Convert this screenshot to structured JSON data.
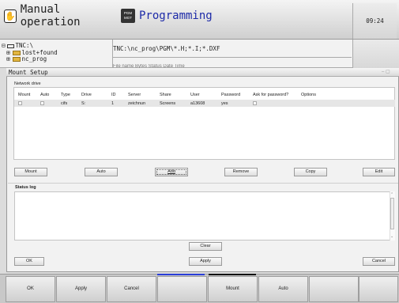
{
  "header": {
    "mode_manual": "Manual operation",
    "mode_programming": "Programming",
    "pgm_badge": "PGM MGT",
    "clock": "09:24"
  },
  "file_manager": {
    "tree": [
      "TNC:\\",
      "lost+found",
      "nc_prog"
    ],
    "path": "TNC:\\nc_prog\\PGM\\*.H;*.I;*.DXF",
    "columns": "File name            Bytes Status   Date      Time"
  },
  "dialog": {
    "title": "Mount Setup",
    "window_controls": "– ▢",
    "network_drive_label": "Network drive",
    "table": {
      "headers": [
        "Mount",
        "Auto",
        "Type",
        "Drive",
        "ID",
        "Server",
        "Share",
        "User",
        "Password",
        "Ask for password?",
        "Options"
      ],
      "rows": [
        {
          "mount": false,
          "auto": false,
          "type": "cifs",
          "drive": "S:",
          "id": "1",
          "server": "zeichnun",
          "share": "Screens",
          "user": "a13608",
          "password": "yes",
          "ask": false,
          "options": ""
        }
      ]
    },
    "buttons": {
      "mount": "Mount",
      "auto": "Auto",
      "add": "Add",
      "remove": "Remove",
      "copy": "Copy",
      "edit": "Edit",
      "clear": "Clear",
      "ok": "OK",
      "apply": "Apply",
      "cancel": "Cancel"
    },
    "status_log_label": "Status log"
  },
  "softkeys": [
    "OK",
    "Apply",
    "Cancel",
    "",
    "Mount",
    "Auto",
    "",
    ""
  ],
  "colors": {
    "programming_text": "#1d2aa8",
    "softkey_bar_active_blue": "#2a3ed8",
    "softkey_bar_active_black": "#111111"
  }
}
